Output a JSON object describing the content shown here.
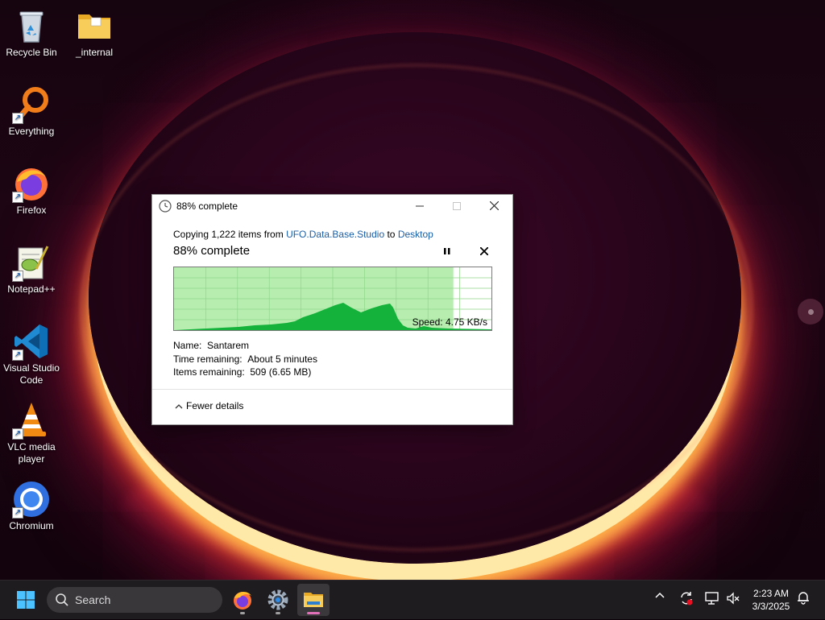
{
  "desktop": {
    "icons": [
      {
        "label": "Recycle Bin",
        "icon": "recycle-bin-icon"
      },
      {
        "label": "_internal",
        "icon": "folder-icon"
      },
      {
        "label": "Everything",
        "icon": "everything-search-icon"
      },
      {
        "label": "Firefox",
        "icon": "firefox-icon"
      },
      {
        "label": "Notepad++",
        "icon": "notepad-plus-plus-icon"
      },
      {
        "label": "Visual Studio Code",
        "icon": "vscode-icon"
      },
      {
        "label": "VLC media player",
        "icon": "vlc-icon"
      },
      {
        "label": "Chromium",
        "icon": "chromium-icon"
      }
    ]
  },
  "dialog": {
    "title": "88% complete",
    "copy_prefix": "Copying 1,222 items from ",
    "source": "UFO.Data.Base.Studio",
    "copy_mid": " to ",
    "destination": "Desktop",
    "status": "88% complete",
    "progress": 0.88,
    "speed": "Speed: 4.75 KB/s",
    "name_label": "Name:",
    "name_value": "Santarem",
    "time_label": "Time remaining:",
    "time_value": "About 5 minutes",
    "items_label": "Items remaining:",
    "items_value": "509 (6.65 MB)",
    "fewer_details": "Fewer details"
  },
  "taskbar": {
    "search_placeholder": "Search",
    "apps": [
      "firefox-icon",
      "settings-icon",
      "file-explorer-icon"
    ],
    "active_app": "file-explorer-icon",
    "clock_time": "2:23 AM",
    "clock_date": "3/3/2025"
  },
  "colors": {
    "progress_fill": "#b7eeb0",
    "graph_green": "#14b23a",
    "link": "#1a5fa8",
    "taskbar": "#1f1c20"
  }
}
